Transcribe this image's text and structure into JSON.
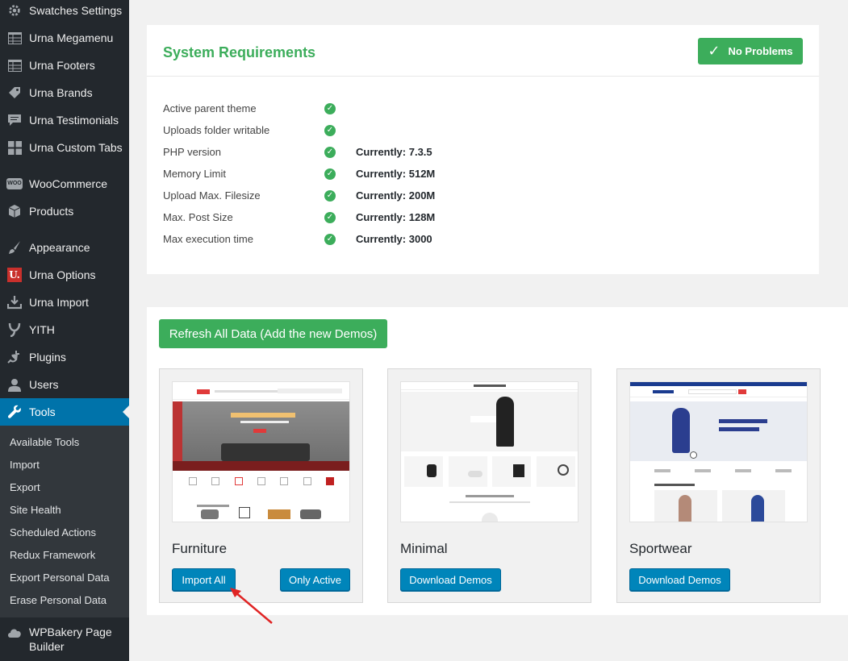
{
  "sidebar": {
    "items": [
      {
        "label": "Swatches Settings",
        "icon": "gear-icon"
      },
      {
        "label": "Urna Megamenu",
        "icon": "table-icon"
      },
      {
        "label": "Urna Footers",
        "icon": "table-icon"
      },
      {
        "label": "Urna Brands",
        "icon": "tag-icon"
      },
      {
        "label": "Urna Testimonials",
        "icon": "comment-icon"
      },
      {
        "label": "Urna Custom Tabs",
        "icon": "grid-icon"
      },
      {
        "label": "WooCommerce",
        "icon": "woo-icon"
      },
      {
        "label": "Products",
        "icon": "box-icon"
      },
      {
        "label": "Appearance",
        "icon": "brush-icon"
      },
      {
        "label": "Urna Options",
        "icon": "urna-logo-icon"
      },
      {
        "label": "Urna Import",
        "icon": "download-icon"
      },
      {
        "label": "YITH",
        "icon": "yith-icon"
      },
      {
        "label": "Plugins",
        "icon": "plug-icon"
      },
      {
        "label": "Users",
        "icon": "user-icon"
      },
      {
        "label": "Tools",
        "icon": "wrench-icon"
      },
      {
        "label": "WPBakery Page Builder",
        "icon": "cloud-icon"
      }
    ],
    "woo_icon_text": "WOO",
    "urna_logo_text": "U.",
    "submenu": [
      "Available Tools",
      "Import",
      "Export",
      "Site Health",
      "Scheduled Actions",
      "Redux Framework",
      "Export Personal Data",
      "Erase Personal Data"
    ]
  },
  "system_requirements": {
    "title": "System Requirements",
    "status_label": "No Problems",
    "rows": [
      {
        "label": "Active parent theme",
        "value": ""
      },
      {
        "label": "Uploads folder writable",
        "value": ""
      },
      {
        "label": "PHP version",
        "value": "Currently: 7.3.5"
      },
      {
        "label": "Memory Limit",
        "value": "Currently: 512M"
      },
      {
        "label": "Upload Max. Filesize",
        "value": "Currently: 200M"
      },
      {
        "label": "Max. Post Size",
        "value": "Currently: 128M"
      },
      {
        "label": "Max execution time",
        "value": "Currently: 3000"
      }
    ]
  },
  "demos": {
    "refresh_label": "Refresh All Data (Add the new Demos)",
    "cards": [
      {
        "name": "Furniture",
        "buttons": [
          "Import All",
          "Only Active"
        ]
      },
      {
        "name": "Minimal",
        "buttons": [
          "Download Demos"
        ]
      },
      {
        "name": "Sportwear",
        "buttons": [
          "Download Demos"
        ]
      }
    ]
  },
  "colors": {
    "sidebar_bg": "#23282d",
    "active_menu": "#0073aa",
    "success_green": "#3cad5b",
    "wp_button": "#0085ba",
    "annotation_arrow": "#e02424"
  }
}
